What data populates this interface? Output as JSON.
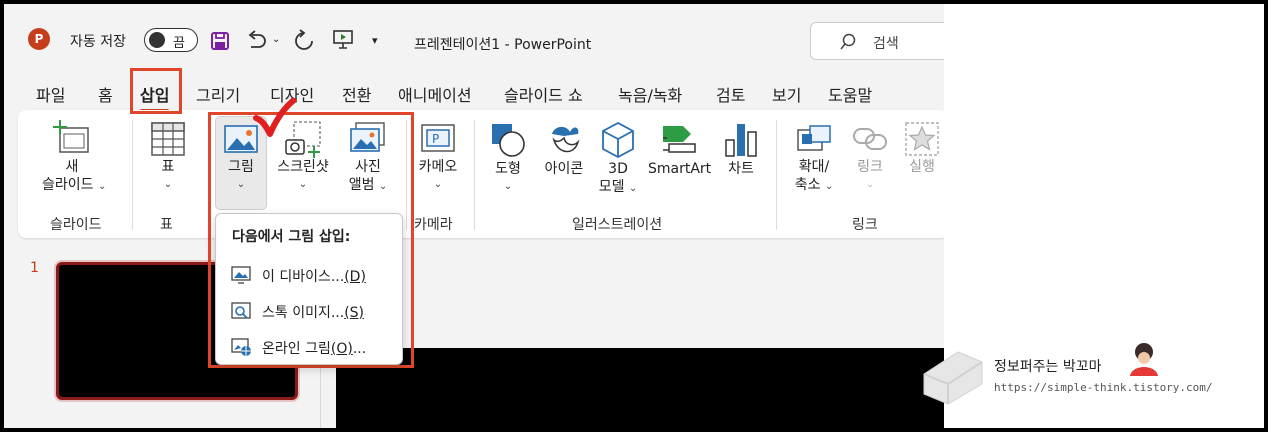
{
  "titlebar": {
    "logo_letter": "P",
    "autosave_label": "자동 저장",
    "autosave_state": "끔",
    "doc_title": "프레젠테이션1  -  PowerPoint",
    "search_placeholder": "검색"
  },
  "tabs": [
    "파일",
    "홈",
    "삽입",
    "그리기",
    "디자인",
    "전환",
    "애니메이션",
    "슬라이드 쇼",
    "녹음/녹화",
    "검토",
    "보기",
    "도움말"
  ],
  "active_tab": "삽입",
  "ribbon": {
    "new_slide_1": "새",
    "new_slide_2": "슬라이드",
    "table": "표",
    "pictures": "그림",
    "screenshot": "스크린샷",
    "photo_album_1": "사진",
    "photo_album_2": "앨범",
    "cameo": "카메오",
    "shapes": "도형",
    "icons": "아이콘",
    "models_1": "3D",
    "models_2": "모델",
    "smartart": "SmartArt",
    "chart": "차트",
    "zoom_1": "확대/",
    "zoom_2": "축소",
    "link": "링크",
    "action": "실행",
    "groups": {
      "slides": "슬라이드",
      "tables": "표",
      "camera": "카메라",
      "illustrations": "일러스트레이션",
      "links": "링크"
    }
  },
  "dropdown": {
    "header": "다음에서 그림 삽입:",
    "items": [
      {
        "label": "이 디바이스...",
        "key": "(D)"
      },
      {
        "label": "스톡 이미지...",
        "key": "(S)"
      },
      {
        "label": "온라인 그림",
        "key": "(O)",
        "suffix": "..."
      }
    ]
  },
  "slides_pane": {
    "slide_number": "1"
  },
  "watermark": {
    "name": "정보퍼주는 박꼬마",
    "url": "https://simple-think.tistory.com/"
  },
  "colors": {
    "accent": "#c43e1c",
    "highlight_box": "#e0472a",
    "checkmark": "#e02020",
    "save_icon": "#7b1fa2"
  }
}
